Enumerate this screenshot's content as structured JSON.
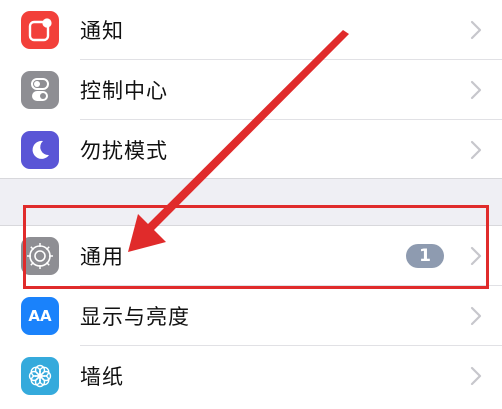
{
  "settings": {
    "group1": [
      {
        "label": "通知",
        "icon": "notifications-icon",
        "color": "#f2403a"
      },
      {
        "label": "控制中心",
        "icon": "control-center-icon",
        "color": "#8e8e93"
      },
      {
        "label": "勿扰模式",
        "icon": "do-not-disturb-moon-icon",
        "color": "#5a55d6"
      }
    ],
    "group2": [
      {
        "label": "通用",
        "icon": "gear-icon",
        "color": "#8e8e93",
        "badge": "1"
      },
      {
        "label": "显示与亮度",
        "icon": "display-brightness-icon",
        "color": "#1a82fb",
        "icon_text": "AA"
      },
      {
        "label": "墙纸",
        "icon": "wallpaper-flower-icon",
        "color": "#35aadc"
      }
    ]
  },
  "annotation": {
    "color": "#e02b2b"
  }
}
